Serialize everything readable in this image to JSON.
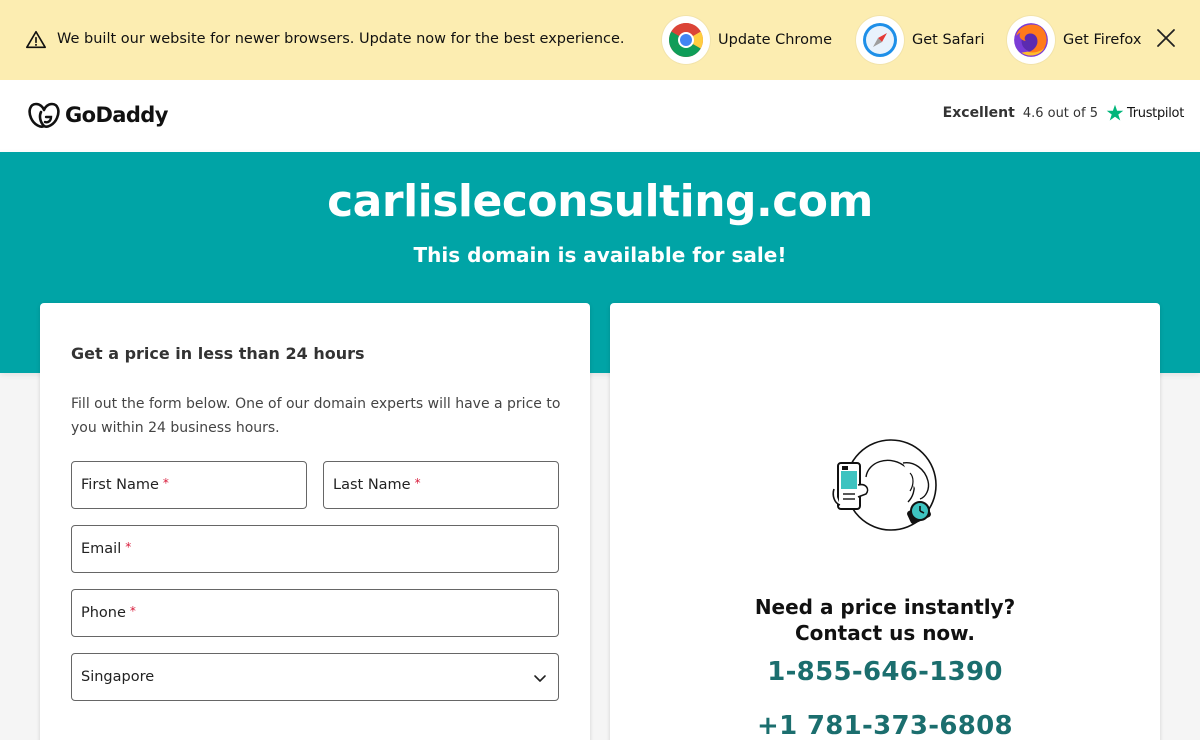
{
  "banner": {
    "message": "We built our website for newer browsers. Update now for the best experience.",
    "browsers": [
      {
        "label": "Update Chrome",
        "icon": "chrome-icon"
      },
      {
        "label": "Get Safari",
        "icon": "safari-icon"
      },
      {
        "label": "Get Firefox",
        "icon": "firefox-icon"
      }
    ]
  },
  "header": {
    "logo_text": "GoDaddy",
    "trustpilot": {
      "rating_word": "Excellent",
      "score": "4.6 out of 5",
      "brand": "Trustpilot"
    }
  },
  "hero": {
    "domain": "carlisleconsulting.com",
    "subtitle": "This domain is available for sale!"
  },
  "form": {
    "title": "Get a price in less than 24 hours",
    "description": "Fill out the form below. One of our domain experts will have a price to you within 24 business hours.",
    "first_name": "First Name",
    "last_name": "Last Name",
    "email": "Email",
    "phone": "Phone",
    "required_mark": "*",
    "country": "Singapore"
  },
  "contact": {
    "line1": "Need a price instantly?",
    "line2": "Contact us now.",
    "phone_1": "1-855-646-1390",
    "phone_2": "+1 781-373-6808"
  },
  "colors": {
    "banner_bg": "#fcedb1",
    "hero_teal": "#00a4a6",
    "phone_text": "#1b6e6e",
    "required": "#d81b3a"
  }
}
